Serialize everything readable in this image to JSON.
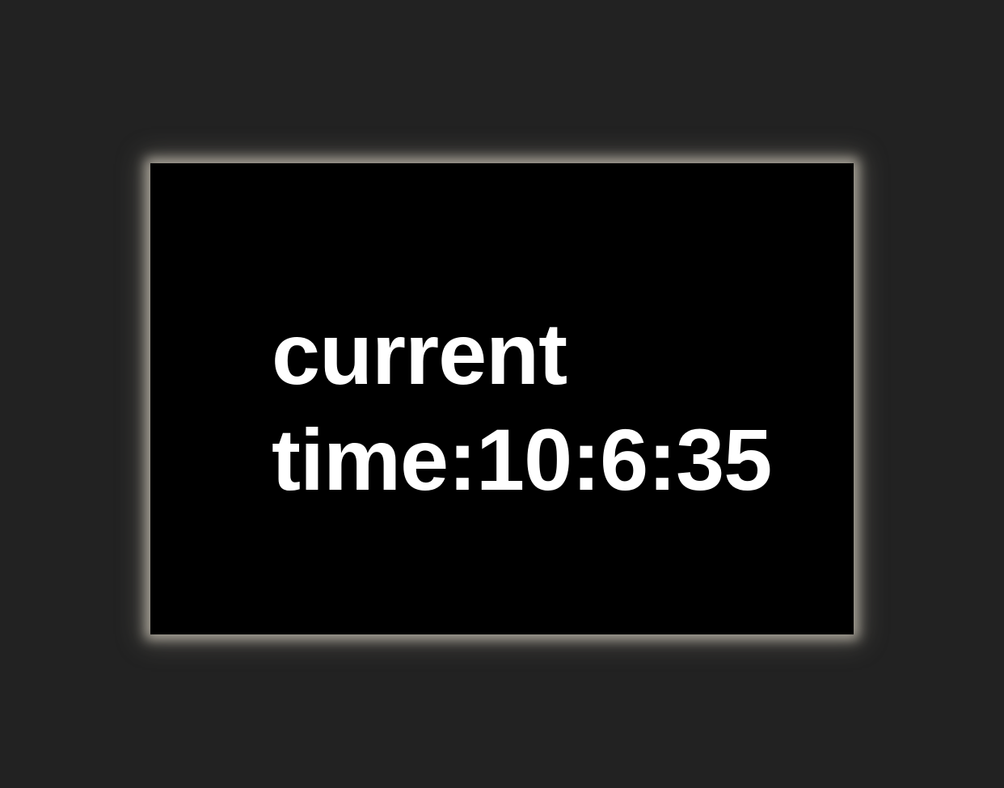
{
  "display": {
    "label": "current",
    "time_prefix": "time:",
    "time_value": "10:6:35"
  },
  "colors": {
    "page_background": "#222222",
    "panel_background": "#000000",
    "panel_glow": "#a8a398",
    "text": "#ffffff"
  }
}
